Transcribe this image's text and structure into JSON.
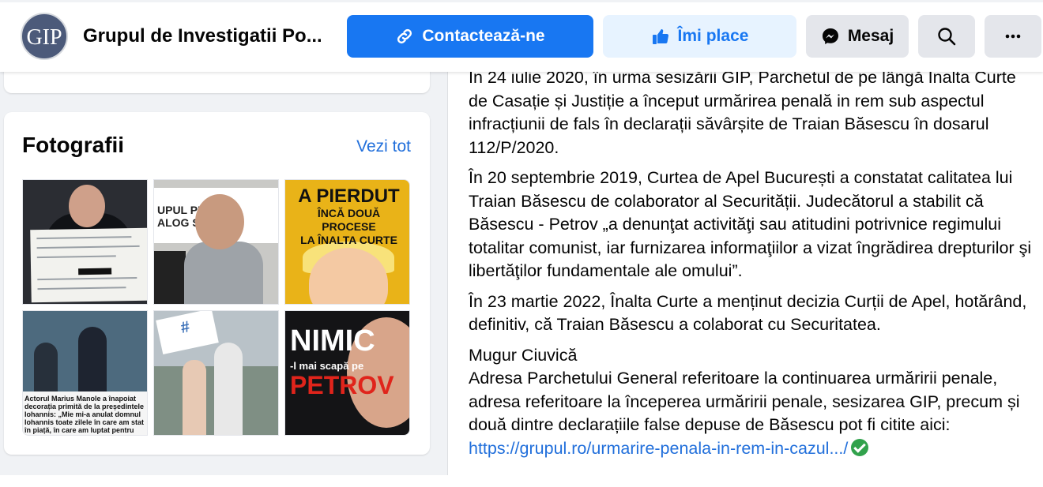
{
  "header": {
    "avatar_text": "GIP",
    "page_name": "Grupul de Investigatii Po...",
    "contact_label": "Contactează-ne",
    "like_label": "Îmi place",
    "message_label": "Mesaj"
  },
  "photos": {
    "title": "Fotografii",
    "see_all": "Vezi tot",
    "tile3_caption_line1": "A PIERDUT",
    "tile3_caption_line2": "ÎNCĂ DOUĂ PROCESE",
    "tile3_caption_line3": "LA ÎNALTA CURTE",
    "tile2_caption": "UPUL PENTRU\nALOG SOCIAL",
    "tile4_caption": "Actorul Marius Manole a înapoiat decorația primită de la președintele Iohannis: „Mie mi-a anulat domnul Iohannis toate zilele în care am stat în piață, în care am luptat pentru legile justiției”",
    "tile6_caption": "NIMIC",
    "tile6_caption2": "-l mai scapă pe",
    "tile6_caption3": "PETROV"
  },
  "post": {
    "paragraphs": [
      "În 24 iulie 2020, în urma sesizării GIP, Parchetul de pe lângă Înalta Curte de Casație și Justiție a început urmărirea penală in rem sub aspectul infracțiunii de fals în declarații săvârșite de Traian Băsescu în dosarul 112/P/2020.",
      "În 20 septembrie 2019, Curtea de Apel București a constatat calitatea lui Traian Băsescu de colaborator al Securității. Judecătorul a stabilit că Băsescu - Petrov „a denunţat activităţi sau atitudini potrivnice regimului totalitar comunist, iar furnizarea informaţiilor a vizat îngrădirea drepturilor şi libertăţilor fundamentale ale omului”.",
      "În 23 martie 2022, Înalta Curte a menținut decizia Curții de Apel, hotărând, definitiv, că Traian Băsescu a colaborat cu Securitatea."
    ],
    "author": "Mugur Ciuvică",
    "closing": "Adresa Parchetului General referitoare la continuarea urmăririi penale, adresa referitoare la începerea urmăririi penale, sesizarea GIP, precum și două dintre declarațiile false depuse de Băsescu pot fi citite aici:",
    "link": "https://grupul.ro/urmarire-penala-in-rem-in-cazul.../"
  },
  "colors": {
    "accent": "#1877f2",
    "link": "#216fdb",
    "like_bg": "#e7f3ff",
    "button_gray": "#e4e6eb"
  },
  "icons": [
    "link-icon",
    "thumbs-up-icon",
    "messenger-icon",
    "search-icon",
    "more-icon",
    "check-icon"
  ]
}
